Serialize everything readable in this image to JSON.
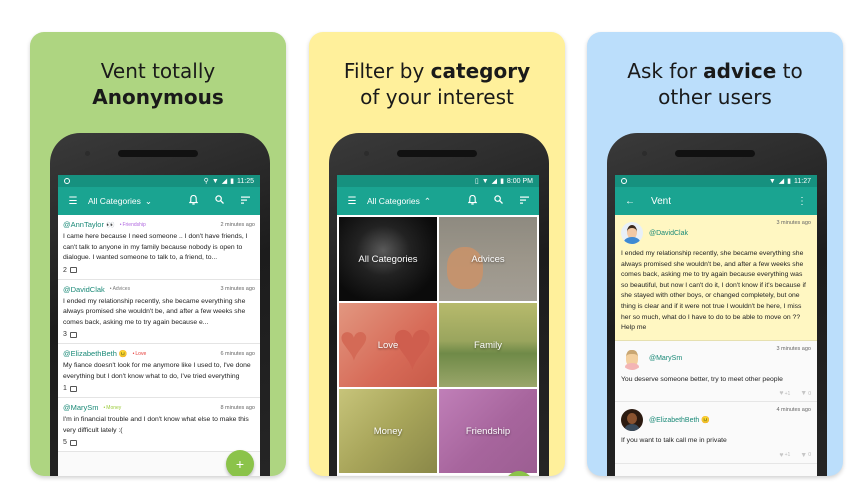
{
  "panels": [
    {
      "headline_plain": "Vent totally",
      "headline_bold": "Anonymous",
      "phone": {
        "status_time": "11:25",
        "toolbar_title": "All Categories",
        "posts": [
          {
            "user": "@AnnTaylor",
            "emoji": "👀",
            "category": "Friendship",
            "category_color": "#b169e0",
            "time": "2 minutes ago",
            "body": "I came here because I need someone .. I don't have friends, I can't talk to anyone in my family because nobody is open to dialogue. I wanted someone to talk to, a friend, to...",
            "comments": "2"
          },
          {
            "user": "@DavidClak",
            "emoji": "",
            "category": "Advices",
            "category_color": "#7a7a7a",
            "time": "3 minutes ago",
            "body": "I ended my relationship recently, she became everything she always promised she wouldn't be, and after a few weeks she comes back, asking me to try again because e...",
            "comments": "3"
          },
          {
            "user": "@ElizabethBeth",
            "emoji": "😐",
            "category": "Love",
            "category_color": "#e53935",
            "time": "6 minutes ago",
            "body": "My fiance doesn't look for me anymore like I used to, I've done everything but I don't know what to do, I've tried everything",
            "comments": "1"
          },
          {
            "user": "@MarySm",
            "emoji": "",
            "category": "Money",
            "category_color": "#9ccc3c",
            "time": "8 minutes ago",
            "body": "I'm in financial trouble and I don't know what else to make this very difficult lately :(",
            "comments": "5"
          }
        ],
        "fab_label": "+"
      }
    },
    {
      "headline_plain_1": "Filter by",
      "headline_bold": "category",
      "headline_plain_2": "of your interest",
      "phone": {
        "status_time": "8:00 PM",
        "toolbar_title": "All Categories",
        "categories": [
          "All Categories",
          "Advices",
          "Love",
          "Family",
          "Money",
          "Friendship"
        ]
      }
    },
    {
      "headline_plain_1": "Ask for",
      "headline_bold": "advice",
      "headline_plain_2": "to",
      "headline_line2": "other users",
      "phone": {
        "status_time": "11:27",
        "toolbar_title": "Vent",
        "vent": {
          "user": "@DavidClak",
          "time": "3 minutes ago",
          "body": "I ended my relationship recently, she became everything she always promised she wouldn't be, and after a few weeks she comes back, asking me to try again because everything was so beautiful, but now I can't do it, I don't know if it's because if she stayed with other boys, or changed completely, but one thing is clear and if it were not true I wouldn't be here, I miss her so much, what do I have to do to be able to move on ?? Help me"
        },
        "replies": [
          {
            "user": "@MarySm",
            "emoji": "",
            "time": "3 minutes ago",
            "body": "You deserve someone better, try to meet other people",
            "likes": "+1",
            "dislikes": "0"
          },
          {
            "user": "@ElizabethBeth",
            "emoji": "😐",
            "time": "4 minutes ago",
            "body": "If you want to talk call me in private",
            "likes": "+1",
            "dislikes": "0"
          }
        ]
      }
    }
  ],
  "icons": {
    "menu": "☰",
    "bell": "🔔",
    "search": "⌕",
    "sort": "≡",
    "chevron_down": "⌄",
    "chevron_up": "⌃",
    "back": "←",
    "more": "⋮",
    "heart": "♥",
    "thumb_down": "▼",
    "location": "⚲",
    "wifi": "▼",
    "signal": "◢",
    "battery": "▮"
  }
}
